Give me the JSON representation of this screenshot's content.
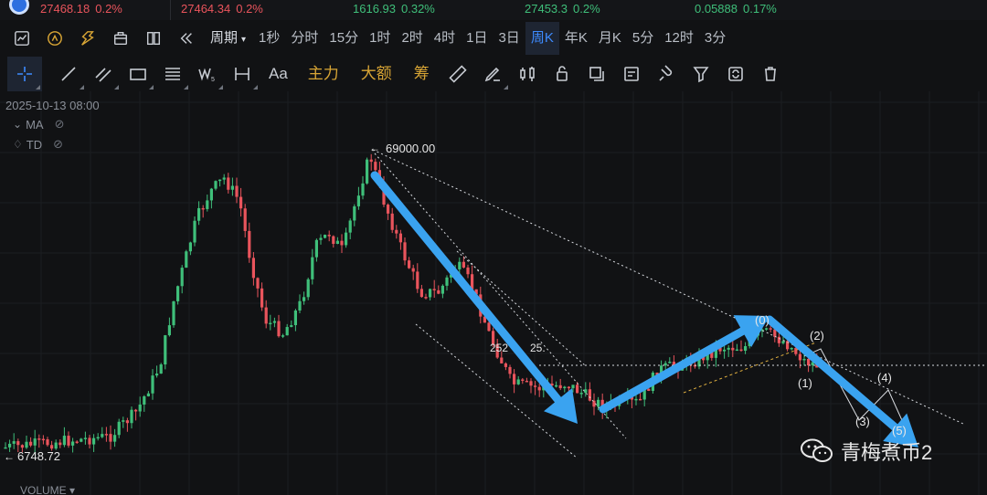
{
  "tickers": [
    {
      "price": "27468.18",
      "pct": "0.2%",
      "color": "#e9545c"
    },
    {
      "price": "27464.34",
      "pct": "0.2%",
      "color": "#e9545c"
    },
    {
      "price": "1616.93",
      "pct": "0.32%",
      "color": "#3fbf7a"
    },
    {
      "price": "27453.3",
      "pct": "0.2%",
      "color": "#3fbf7a"
    },
    {
      "price": "0.05888",
      "pct": "0.17%",
      "color": "#3fbf7a"
    }
  ],
  "toolbar": {
    "period_label": "周期",
    "intervals": [
      "1秒",
      "分时",
      "15分",
      "1时",
      "2时",
      "4时",
      "1日",
      "3日",
      "周K",
      "年K",
      "月K",
      "5分",
      "12时",
      "3分"
    ],
    "active_interval": "周K"
  },
  "drawing_toolbar": {
    "main_force": "主力",
    "large_order": "大额",
    "chips": "筹",
    "text_tool": "Aa"
  },
  "chart": {
    "timestamp": "2025-10-13 08:00",
    "indicators": [
      "MA",
      "TD"
    ],
    "high_label": "69000.00",
    "low_label": "6748.72",
    "annotations": [
      "252",
      "25.",
      "(0)",
      "(1)",
      "(2)",
      "(3)",
      "(4)",
      "(5)"
    ],
    "volume_label": "VOLUME",
    "watermark": "青梅煮币2",
    "colors": {
      "up": "#3fbf7a",
      "down": "#e9545c",
      "arrow": "#3aa3f0"
    }
  }
}
